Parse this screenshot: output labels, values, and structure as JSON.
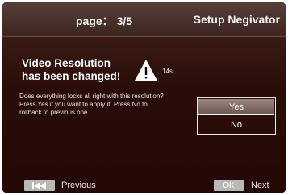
{
  "header": {
    "page_indicator": "page： 3/5",
    "title": "Setup Negivator"
  },
  "dialog": {
    "title_line1": "Video Resolution",
    "title_line2": "has been changed!",
    "countdown": "14s",
    "icon": "warning-icon",
    "message_lines": [
      "Does everything locks all right with this resolution?",
      "Press Yes if you want to apply it. Press No to",
      "rollback to previous one."
    ],
    "options": [
      {
        "label": "Yes",
        "selected": true
      },
      {
        "label": "No",
        "selected": false
      }
    ]
  },
  "footer": {
    "previous_label": "Previous",
    "previous_icon": "skip-back-icon",
    "ok_label": "OK",
    "next_label": "Next"
  }
}
